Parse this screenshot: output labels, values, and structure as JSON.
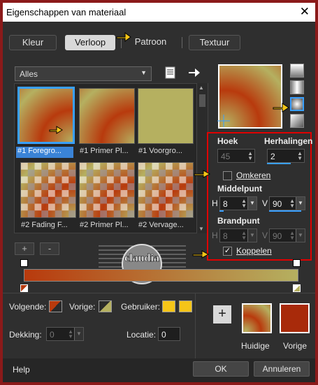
{
  "window": {
    "title": "Eigenschappen van materiaal",
    "close_glyph": "✕"
  },
  "tabs": [
    {
      "label": "Kleur"
    },
    {
      "label": "Verloop"
    },
    {
      "label": "Patroon"
    },
    {
      "label": "Textuur"
    }
  ],
  "category_select": {
    "value": "Alles"
  },
  "gradients": [
    {
      "label": "#1 Foregro...",
      "selected": true
    },
    {
      "label": "#1 Primer Pl..."
    },
    {
      "label": "#1 Voorgro..."
    },
    {
      "label": "#2 Fading F..."
    },
    {
      "label": "#2 Primer Pl..."
    },
    {
      "label": "#2 Vervage..."
    }
  ],
  "small_buttons": {
    "add": "+",
    "remove": "-"
  },
  "properties": {
    "angle": {
      "label": "Hoek",
      "value": "45"
    },
    "repeats": {
      "label": "Herhalingen",
      "value": "2"
    },
    "invert": {
      "label": "Omkeren",
      "checked": false
    },
    "center": {
      "label": "Middelpunt",
      "h_label": "H",
      "h_value": "8",
      "v_label": "V",
      "v_value": "90"
    },
    "focus": {
      "label": "Brandpunt",
      "h_label": "H",
      "h_value": "8",
      "v_label": "V",
      "v_value": "90"
    },
    "link": {
      "label": "Koppelen",
      "checked": true
    }
  },
  "stops": {
    "next_label": "Volgende:",
    "prev_label": "Vorige:",
    "user_label": "Gebruiker:",
    "opacity_label": "Dekking:",
    "opacity_value": "0",
    "location_label": "Locatie:",
    "location_value": "0"
  },
  "compare": {
    "current_label": "Huidige",
    "previous_label": "Vorige",
    "add_label": "+"
  },
  "footer": {
    "help": "Help",
    "ok": "OK",
    "cancel": "Annuleren"
  },
  "watermark": {
    "text": "claudia"
  },
  "colors": {
    "foreground": "#b83a0d",
    "background": "#b5b060",
    "user": "#f5c518",
    "accent": "#3aa0ff",
    "highlight_frame": "#e00000"
  }
}
